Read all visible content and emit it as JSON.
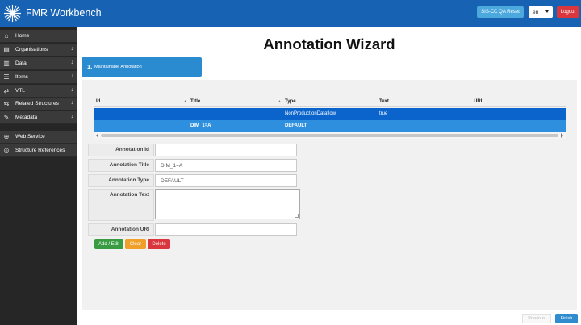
{
  "header": {
    "app_title": "FMR Workbench",
    "reset_label": "SIS-CC QA Reset",
    "lang_value": "en",
    "logout_label": "Logout",
    "bar_color": "#1762b3"
  },
  "sidebar": {
    "items": [
      {
        "label": "Home",
        "icon": "home-icon",
        "glyph": "⌂",
        "arrow": ""
      },
      {
        "label": "Organisations",
        "icon": "building-icon",
        "glyph": "▤",
        "arrow": "↓"
      },
      {
        "label": "Data",
        "icon": "bar-chart-icon",
        "glyph": "▥",
        "arrow": "↓"
      },
      {
        "label": "Items",
        "icon": "list-icon",
        "glyph": "☰",
        "arrow": "↓"
      },
      {
        "label": "VTL",
        "icon": "shuffle-icon",
        "glyph": "⇄",
        "arrow": "↓"
      },
      {
        "label": "Related Structures",
        "icon": "exchange-icon",
        "glyph": "⇆",
        "arrow": "↓"
      },
      {
        "label": "Metadata",
        "icon": "pencil-icon",
        "glyph": "✎",
        "arrow": "↓"
      },
      {
        "label": "Web Service",
        "icon": "globe-icon",
        "glyph": "⊕",
        "arrow": ""
      },
      {
        "label": "Structure References",
        "icon": "target-icon",
        "glyph": "◎",
        "arrow": ""
      }
    ]
  },
  "main": {
    "page_title": "Annotation Wizard",
    "step": {
      "number": "1.",
      "label": "Maintainable Annotation"
    }
  },
  "grid": {
    "columns": [
      "Id",
      "Title",
      "Type",
      "Text",
      "URI"
    ],
    "rows": [
      {
        "id": "",
        "title": "",
        "type": "NonProductionDataflow",
        "text": "true",
        "uri": ""
      },
      {
        "id": "",
        "title": "DIM_1=A",
        "type": "DEFAULT",
        "text": "",
        "uri": ""
      }
    ]
  },
  "form": {
    "fields": [
      {
        "label": "Annotation Id",
        "value": ""
      },
      {
        "label": "Annotation Title",
        "value": "DIM_1=A"
      },
      {
        "label": "Annotation Type",
        "value": "DEFAULT"
      },
      {
        "label": "Annotation Text",
        "value": ""
      },
      {
        "label": "Annotation URI",
        "value": ""
      }
    ],
    "buttons": {
      "add": "Add / Edit",
      "clear": "Clear",
      "delete": "Delete"
    }
  },
  "footer": {
    "previous": "Previous",
    "finish": "Finish"
  }
}
